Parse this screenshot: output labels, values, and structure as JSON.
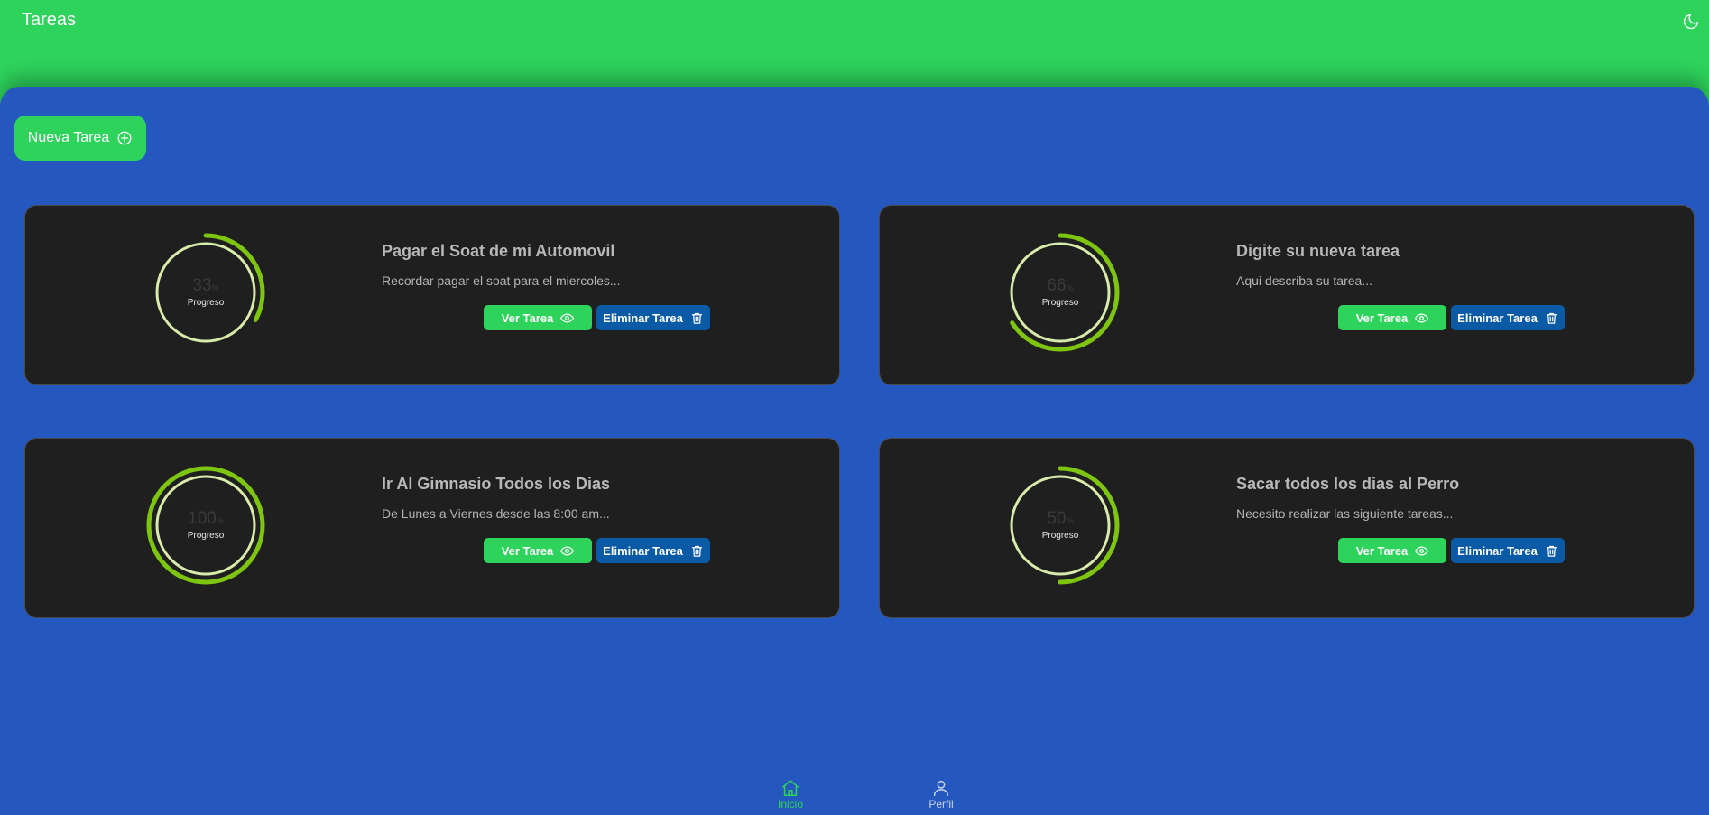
{
  "header": {
    "title": "Tareas",
    "theme_toggle_icon": "moon-icon"
  },
  "toolbar": {
    "new_task_label": "Nueva Tarea",
    "new_task_icon": "plus-circle-icon"
  },
  "colors": {
    "header_bg": "#2ed35c",
    "main_bg": "#2558bf",
    "card_bg": "#1f1f1f",
    "view_button": "#2ed35c",
    "delete_button": "#0b5aa6",
    "progress_track": "#d8ebab",
    "progress_fill": "#7ec512"
  },
  "tasks": [
    {
      "title": "Pagar el Soat de mi Automovil",
      "description": "Recordar pagar el soat para el miercoles...",
      "progress": 33,
      "progress_unit": "%",
      "progress_label": "Progreso",
      "view_label": "Ver Tarea",
      "view_icon": "eye-icon",
      "delete_label": "Eliminar Tarea",
      "delete_icon": "trash-icon"
    },
    {
      "title": "Digite su nueva tarea",
      "description": "Aqui describa su tarea...",
      "progress": 66,
      "progress_unit": "%",
      "progress_label": "Progreso",
      "view_label": "Ver Tarea",
      "view_icon": "eye-icon",
      "delete_label": "Eliminar Tarea",
      "delete_icon": "trash-icon"
    },
    {
      "title": "Ir Al Gimnasio Todos los Dias",
      "description": "De Lunes a Viernes desde las 8:00 am...",
      "progress": 100,
      "progress_unit": "%",
      "progress_label": "Progreso",
      "view_label": "Ver Tarea",
      "view_icon": "eye-icon",
      "delete_label": "Eliminar Tarea",
      "delete_icon": "trash-icon"
    },
    {
      "title": "Sacar todos los dias al Perro",
      "description": "Necesito realizar las siguiente tareas...",
      "progress": 50,
      "progress_unit": "%",
      "progress_label": "Progreso",
      "view_label": "Ver Tarea",
      "view_icon": "eye-icon",
      "delete_label": "Eliminar Tarea",
      "delete_icon": "trash-icon"
    }
  ],
  "bottom_nav": {
    "items": [
      {
        "label": "Inicio",
        "icon": "home-icon",
        "active": true
      },
      {
        "label": "Perfil",
        "icon": "user-icon",
        "active": false
      }
    ]
  }
}
